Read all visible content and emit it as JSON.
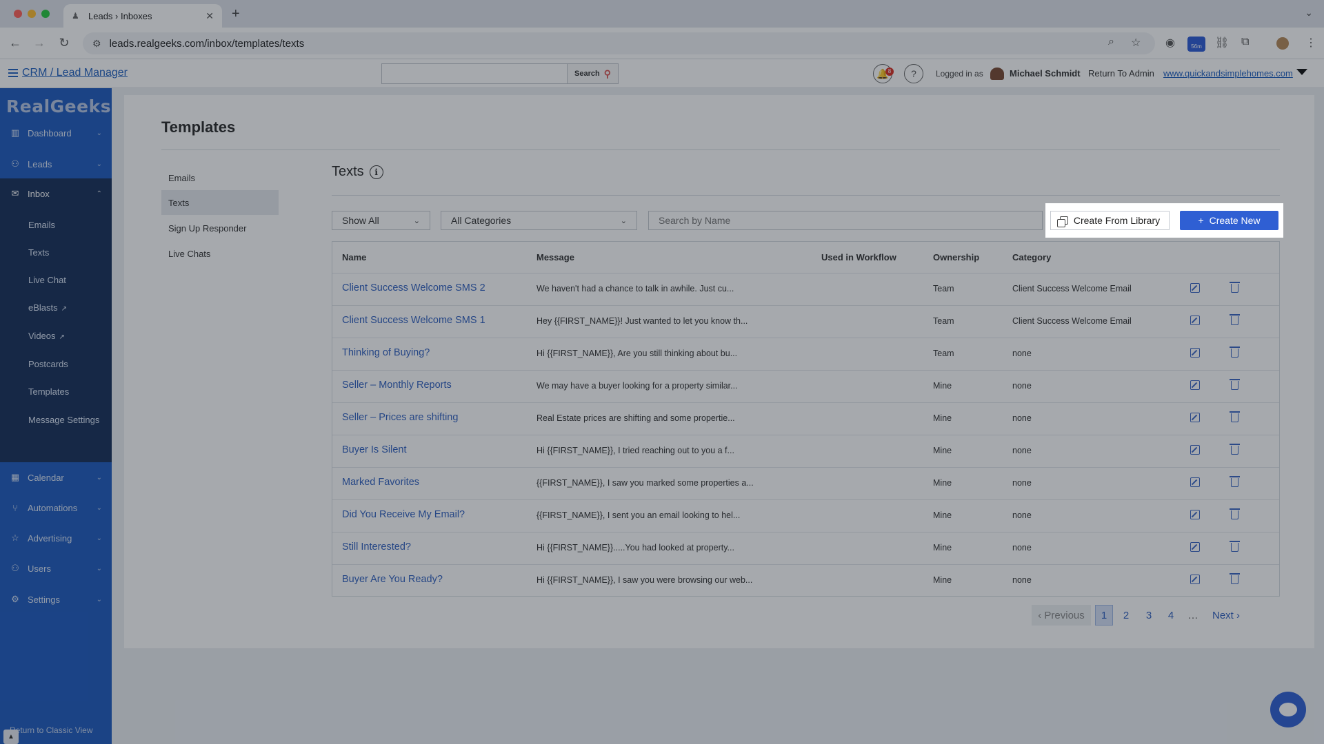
{
  "browser": {
    "tab_title": "Leads › Inboxes",
    "url": "leads.realgeeks.com/inbox/templates/texts",
    "ext_badge": "56m"
  },
  "header": {
    "crm_link": "CRM / Lead Manager",
    "search_button": "Search",
    "notification_count": "8",
    "logged_in_label": "Logged in as",
    "username": "Michael Schmidt",
    "return_admin": "Return To Admin",
    "site_link": "www.quickandsimplehomes.com"
  },
  "sidebar": {
    "logo": "RealGeeks",
    "items": [
      {
        "label": "Dashboard",
        "icon": "chart-icon"
      },
      {
        "label": "Leads",
        "icon": "users-icon"
      },
      {
        "label": "Inbox",
        "icon": "mail-icon"
      },
      {
        "label": "Calendar",
        "icon": "calendar-icon"
      },
      {
        "label": "Automations",
        "icon": "automation-icon"
      },
      {
        "label": "Advertising",
        "icon": "star-icon"
      },
      {
        "label": "Users",
        "icon": "user-icon"
      },
      {
        "label": "Settings",
        "icon": "gear-icon"
      }
    ],
    "inbox_sub": [
      "Emails",
      "Texts",
      "Live Chat",
      "eBlasts",
      "Videos",
      "Postcards",
      "Templates",
      "Message Settings"
    ],
    "classic_view": "Return to Classic View"
  },
  "page": {
    "title": "Templates",
    "sub_nav": [
      "Emails",
      "Texts",
      "Sign Up Responder",
      "Live Chats"
    ],
    "section_title": "Texts",
    "filter_show": "Show All",
    "filter_category": "All Categories",
    "search_placeholder": "Search by Name",
    "create_from_library": "Create From Library",
    "create_new": "Create New"
  },
  "table": {
    "headers": [
      "Name",
      "Message",
      "Used in Workflow",
      "Ownership",
      "Category"
    ],
    "rows": [
      {
        "name": "Client Success Welcome SMS 2",
        "message": "We haven't had a chance to talk in awhile. Just cu...",
        "workflow": "",
        "ownership": "Team",
        "category": "Client Success Welcome Email"
      },
      {
        "name": "Client Success Welcome SMS 1",
        "message": "Hey {{FIRST_NAME}}! Just wanted to let you know th...",
        "workflow": "",
        "ownership": "Team",
        "category": "Client Success Welcome Email"
      },
      {
        "name": "Thinking of Buying?",
        "message": "Hi {{FIRST_NAME}}, Are you still thinking about bu...",
        "workflow": "",
        "ownership": "Team",
        "category": "none"
      },
      {
        "name": "Seller – Monthly Reports",
        "message": "We may have a buyer looking for a property similar...",
        "workflow": "",
        "ownership": "Mine",
        "category": "none"
      },
      {
        "name": "Seller – Prices are shifting",
        "message": "Real Estate prices are shifting and some propertie...",
        "workflow": "",
        "ownership": "Mine",
        "category": "none"
      },
      {
        "name": "Buyer Is Silent",
        "message": "Hi {{FIRST_NAME}}, I tried reaching out to you a f...",
        "workflow": "",
        "ownership": "Mine",
        "category": "none"
      },
      {
        "name": "Marked Favorites",
        "message": "{{FIRST_NAME}}, I saw you marked some properties a...",
        "workflow": "",
        "ownership": "Mine",
        "category": "none"
      },
      {
        "name": "Did You Receive My Email?",
        "message": "{{FIRST_NAME}}, I sent you an email looking to hel...",
        "workflow": "",
        "ownership": "Mine",
        "category": "none"
      },
      {
        "name": "Still Interested?",
        "message": "Hi {{FIRST_NAME}}.....You had looked at property...",
        "workflow": "",
        "ownership": "Mine",
        "category": "none"
      },
      {
        "name": "Buyer Are You Ready?",
        "message": "Hi {{FIRST_NAME}}, I saw you were browsing our web...",
        "workflow": "",
        "ownership": "Mine",
        "category": "none"
      }
    ]
  },
  "pagination": {
    "previous": "Previous",
    "pages": [
      "1",
      "2",
      "3",
      "4"
    ],
    "ellipsis": "…",
    "next": "Next",
    "current": "1"
  }
}
